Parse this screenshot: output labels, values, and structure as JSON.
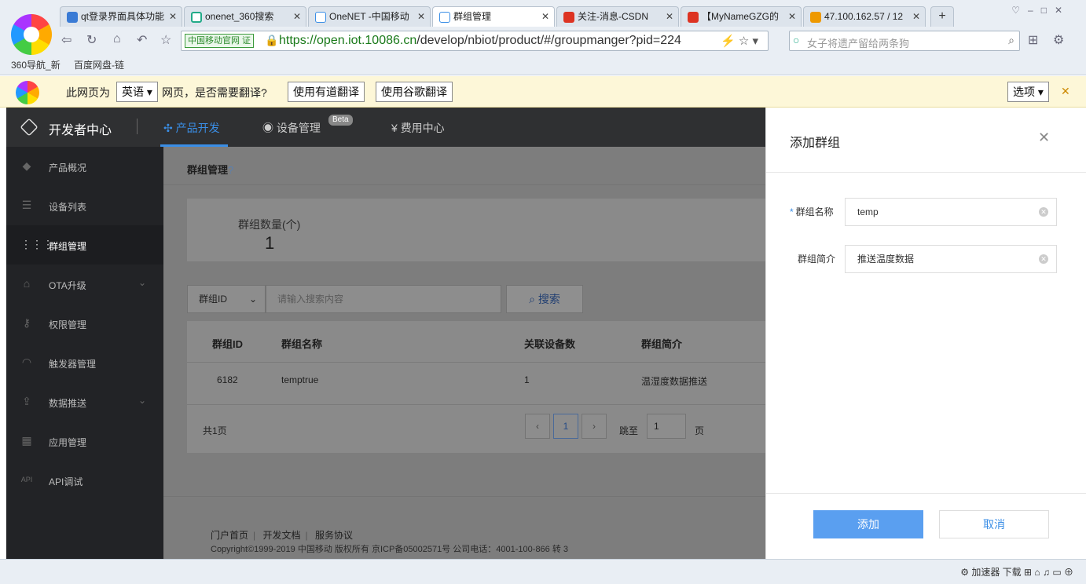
{
  "browser": {
    "tabs": [
      {
        "label": "qt登录界面具体功能",
        "active": false
      },
      {
        "label": "onenet_360搜索",
        "active": false
      },
      {
        "label": "OneNET -中国移动",
        "active": false
      },
      {
        "label": "群组管理",
        "active": true
      },
      {
        "label": "关注-消息-CSDN",
        "active": false
      },
      {
        "label": "【MyNameGZG的",
        "active": false
      },
      {
        "label": "47.100.162.57 / 12",
        "active": false
      }
    ],
    "new_tab": "+",
    "security_badge": "中国移动官网 证",
    "url_host": "https://open.iot.10086.cn",
    "url_path": "/develop/nbiot/product/#/groupmanger?pid=224",
    "search_placeholder": "女子将遗产留给两条狗",
    "bookmarks": [
      "360导航_新",
      "百度网盘-链"
    ]
  },
  "translate_bar": {
    "prefix": "此网页为",
    "lang": "英语 ▾",
    "question": "网页，是否需要翻译?",
    "youdao": "使用有道翻译",
    "google": "使用谷歌翻译",
    "options": "选项 ▾",
    "close": "✕"
  },
  "header": {
    "brand": "开发者中心",
    "nav": [
      {
        "label": "产品开发",
        "active": true
      },
      {
        "label": "设备管理",
        "active": false
      },
      {
        "label": "费用中心",
        "active": false
      }
    ],
    "beta": "Beta"
  },
  "sidebar": {
    "items": [
      {
        "label": "产品概况",
        "icon": "cube-icon",
        "active": false
      },
      {
        "label": "设备列表",
        "icon": "list-icon",
        "active": false
      },
      {
        "label": "群组管理",
        "icon": "grid-icon",
        "active": true
      },
      {
        "label": "OTA升级",
        "icon": "ota-icon",
        "active": false,
        "expand": true
      },
      {
        "label": "权限管理",
        "icon": "key-icon",
        "active": false
      },
      {
        "label": "触发器管理",
        "icon": "trigger-icon",
        "active": false
      },
      {
        "label": "数据推送",
        "icon": "push-icon",
        "active": false,
        "expand": true
      },
      {
        "label": "应用管理",
        "icon": "apps-icon",
        "active": false
      },
      {
        "label": "API调试",
        "icon": "api-icon",
        "active": false
      }
    ]
  },
  "main": {
    "breadcrumb": "群组管理",
    "help": "?",
    "stat_label": "群组数量(个)",
    "stat_value": "1",
    "filter_field": "群组ID",
    "filter_placeholder": "请输入搜索内容",
    "search_label": "搜索",
    "table": {
      "headers": [
        "群组ID",
        "群组名称",
        "关联设备数",
        "群组简介"
      ],
      "rows": [
        [
          "6182",
          "temptrue",
          "1",
          "温湿度数据推送"
        ]
      ]
    },
    "total": "共1页",
    "page": "1",
    "jump_label": "跳至",
    "jump_value": "1",
    "jump_unit": "页",
    "footer_links": [
      "门户首页",
      "开发文档",
      "服务协议"
    ],
    "copyright": "Copyright©1999-2019 中国移动 版权所有 京ICP备05002571号 公司电话：4001-100-866 转 3"
  },
  "drawer": {
    "title": "添加群组",
    "name_label": "群组名称",
    "name_value": "temp",
    "desc_label": "群组简介",
    "desc_value": "推送温度数据",
    "add": "添加",
    "cancel": "取消"
  },
  "statusbar": {
    "items": "加速器   下载"
  },
  "colors": {
    "accent": "#3a8ee6",
    "button": "#5a9ff0",
    "header": "#2f3032",
    "sidebar": "#222326"
  }
}
